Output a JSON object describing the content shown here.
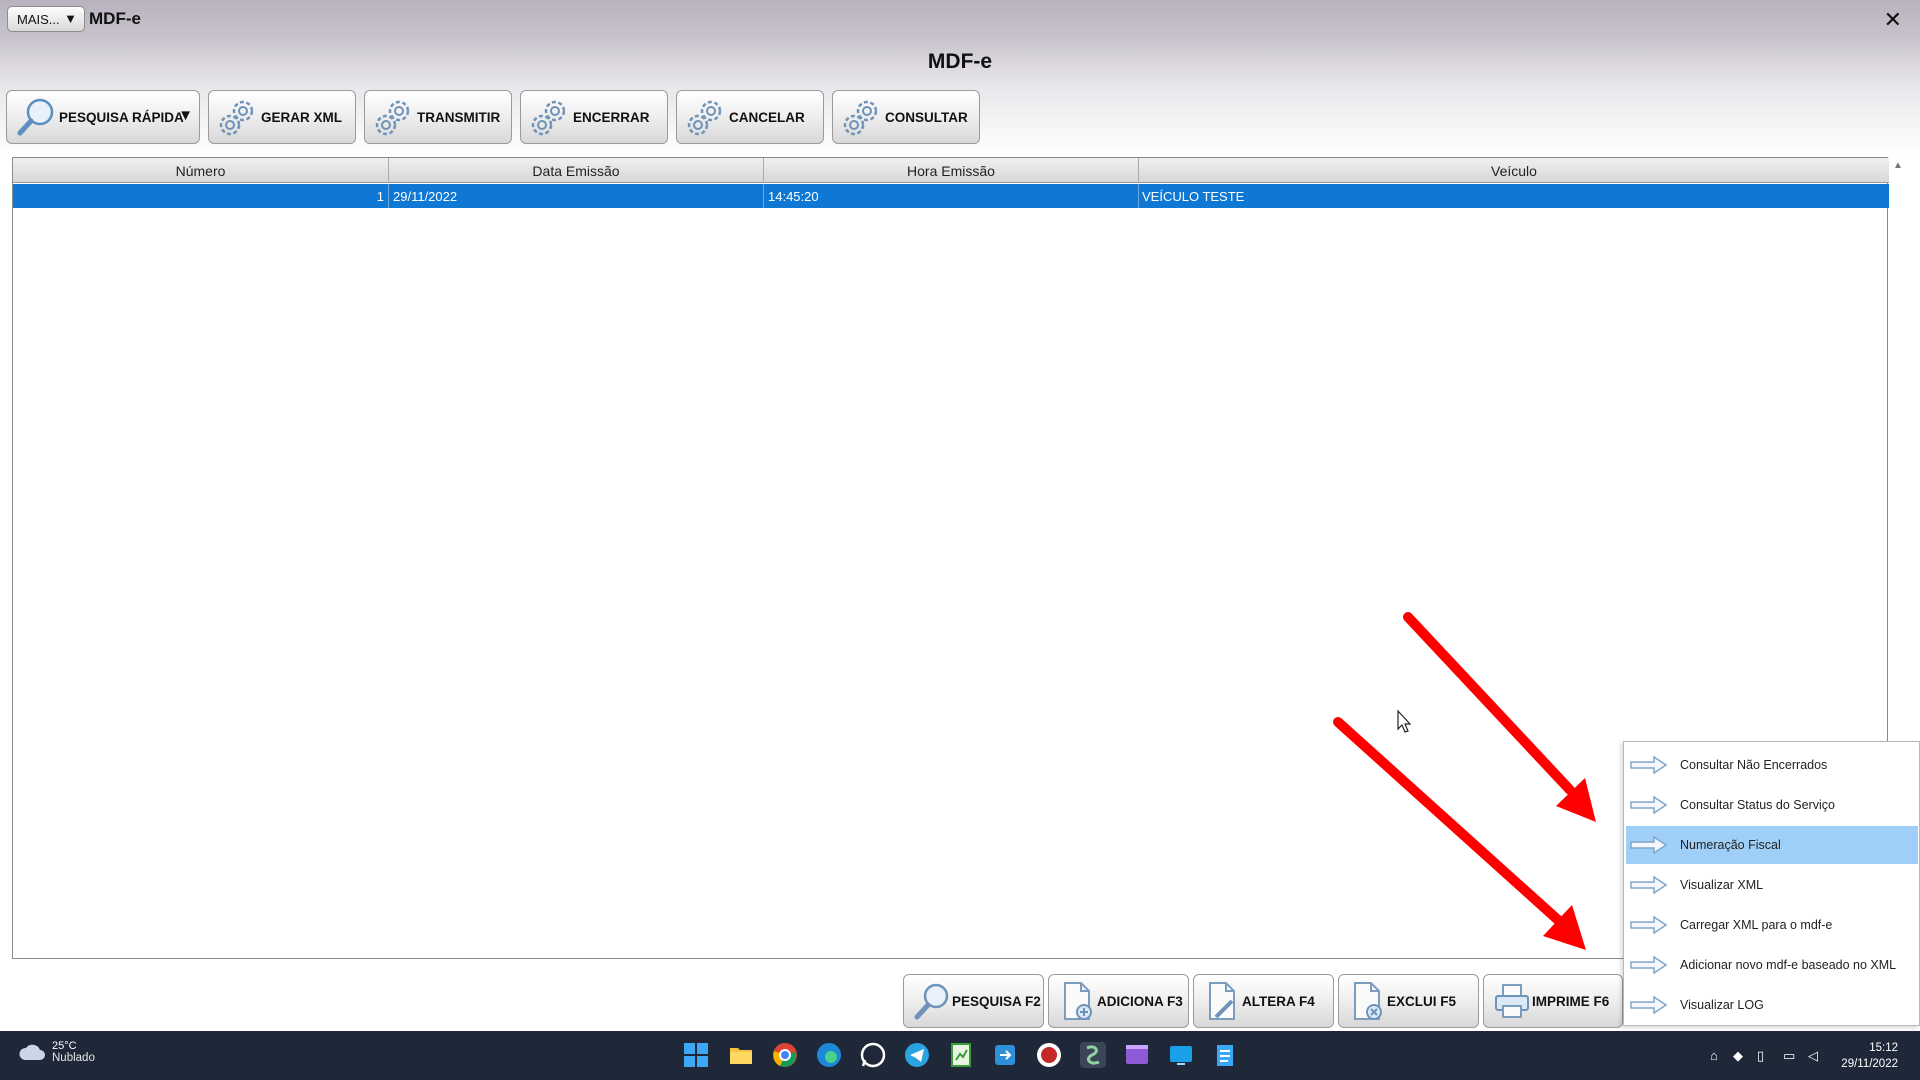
{
  "titlebar": {
    "menu_button": "MAIS...",
    "app_title": "MDF-e",
    "close": "✕"
  },
  "form": {
    "title": "MDF-e"
  },
  "toolbar": {
    "pesquisa_rapida": "PESQUISA RÁPIDA",
    "gerar_xml": "GERAR XML",
    "transmitir": "TRANSMITIR",
    "encerrar": "ENCERRAR",
    "cancelar": "CANCELAR",
    "consultar": "CONSULTAR"
  },
  "grid": {
    "columns": [
      "Número",
      "Data Emissão",
      "Hora Emissão",
      "Veículo"
    ],
    "rows": [
      {
        "numero": "1",
        "data": "29/11/2022",
        "hora": "14:45:20",
        "veiculo": "VEÍCULO TESTE"
      }
    ]
  },
  "bottom_buttons": {
    "pesquisa": "PESQUISA F2",
    "adiciona": "ADICIONA F3",
    "altera": "ALTERA F4",
    "exclui": "EXCLUI F5",
    "imprime": "IMPRIME F6"
  },
  "popup_menu": {
    "items": [
      "Consultar Não Encerrados",
      "Consultar Status do Serviço",
      "Numeração Fiscal",
      "Visualizar XML",
      "Carregar XML para o mdf-e",
      "Adicionar novo mdf-e baseado no XML",
      "Visualizar LOG"
    ],
    "selected": "Numeração Fiscal"
  },
  "taskbar": {
    "weather_temp": "25°C",
    "weather_condition": "Nublado",
    "time": "15:12",
    "date": "29/11/2022"
  },
  "colors": {
    "selection_blue": "#0f78d4",
    "menu_highlight": "#9fcff7",
    "annotation_red": "#ff0000",
    "taskbar": "#1f2838"
  }
}
